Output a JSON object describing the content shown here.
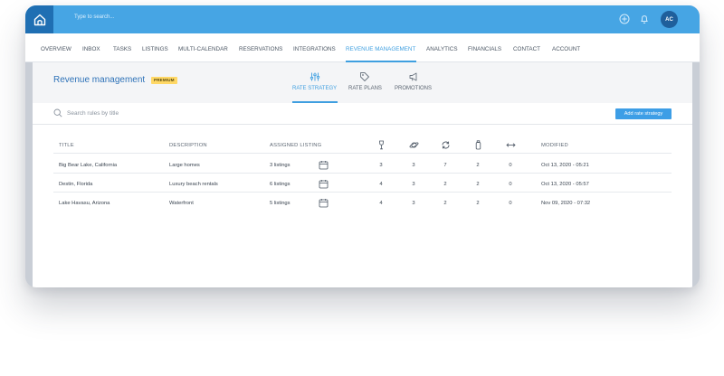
{
  "topbar": {
    "search_placeholder": "Type to search...",
    "avatar_initials": "AC",
    "color": "#46a5e4"
  },
  "nav": {
    "items": [
      "OVERVIEW",
      "INBOX",
      "TASKS",
      "LISTINGS",
      "MULTI-CALENDAR",
      "RESERVATIONS",
      "INTEGRATIONS",
      "REVENUE MANAGEMENT",
      "ANALYTICS",
      "FINANCIALS",
      "CONTACT",
      "ACCOUNT"
    ],
    "active": "REVENUE MANAGEMENT"
  },
  "page": {
    "title": "Revenue management",
    "badge": "PREMIUM",
    "tabs": [
      {
        "label": "RATE STRATEGY",
        "icon": "sliders-icon",
        "active": true
      },
      {
        "label": "RATE PLANS",
        "icon": "tag-icon",
        "active": false
      },
      {
        "label": "PROMOTIONS",
        "icon": "megaphone-icon",
        "active": false
      }
    ]
  },
  "search": {
    "placeholder": "Search rules by title"
  },
  "actions": {
    "add_label": "Add rate strategy"
  },
  "table": {
    "headers": {
      "title": "TITLE",
      "description": "DESCRIPTION",
      "assigned": "ASSIGNED LISTING",
      "col1_icon": "wine-glass-icon",
      "col2_icon": "planet-icon",
      "col3_icon": "refresh-icon",
      "col4_icon": "bottle-icon",
      "col5_icon": "arrows-horizontal-icon",
      "modified": "MODIFIED"
    },
    "rows": [
      {
        "title": "Big Bear Lake, California",
        "description": "Large homes",
        "assigned": "3 listings",
        "c1": "3",
        "c2": "3",
        "c3": "7",
        "c4": "2",
        "c5": "0",
        "modified": "Oct 13, 2020 - 05:21"
      },
      {
        "title": "Destin, Florida",
        "description": "Luxury beach rentals",
        "assigned": "6 listings",
        "c1": "4",
        "c2": "3",
        "c3": "2",
        "c4": "2",
        "c5": "0",
        "modified": "Oct 13, 2020 - 05:57"
      },
      {
        "title": "Lake Havasu, Arizona",
        "description": "Waterfront",
        "assigned": "5 listings",
        "c1": "4",
        "c2": "3",
        "c3": "2",
        "c4": "2",
        "c5": "0",
        "modified": "Nov 09, 2020 - 07:32"
      }
    ]
  },
  "colors": {
    "accent": "#3f9fe0",
    "brand_dark": "#1f6fb3",
    "badge": "#ffd866"
  }
}
